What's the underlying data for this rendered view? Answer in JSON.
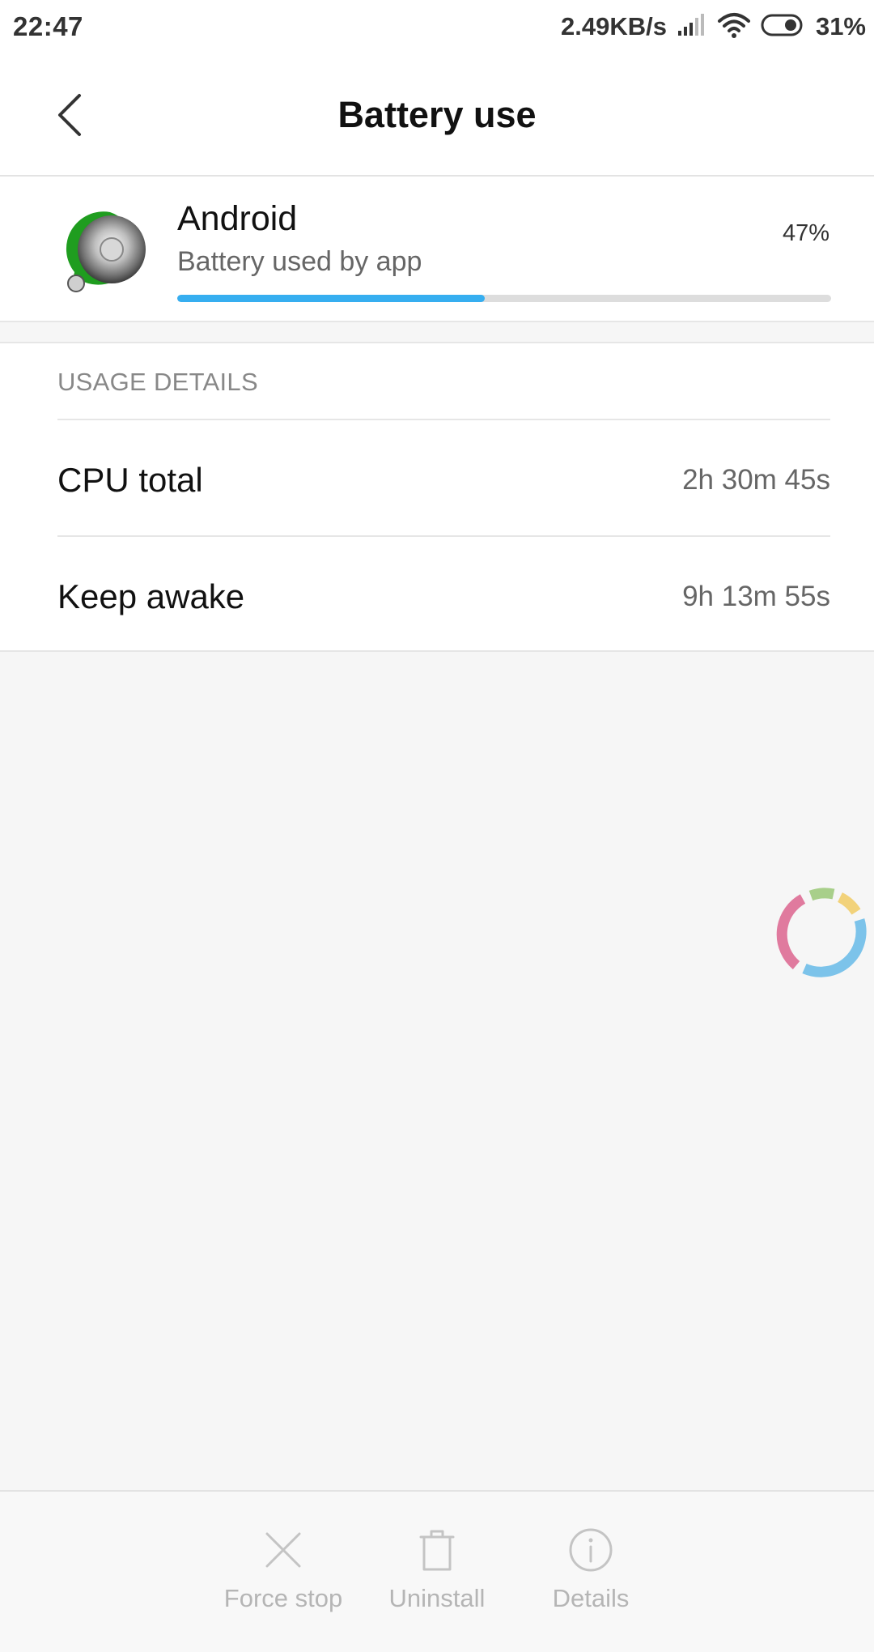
{
  "status_bar": {
    "time": "22:47",
    "network_speed": "2.49KB/s",
    "battery_percent": "31%",
    "icons": [
      "signal-icon",
      "wifi-icon",
      "battery-icon"
    ]
  },
  "header": {
    "title": "Battery use",
    "back_icon": "chevron-left-icon"
  },
  "app": {
    "name": "Android",
    "subtitle": "Battery used by app",
    "usage_percent_label": "47%",
    "usage_fraction": 0.47,
    "progress_color": "#36aef0"
  },
  "usage_details": {
    "section_title": "USAGE DETAILS",
    "rows": [
      {
        "label": "CPU total",
        "value": "2h 30m 45s"
      },
      {
        "label": "Keep awake",
        "value": "9h 13m 55s"
      }
    ]
  },
  "actions": [
    {
      "label": "Force stop",
      "icon": "close-icon"
    },
    {
      "label": "Uninstall",
      "icon": "trash-icon"
    },
    {
      "label": "Details",
      "icon": "info-icon"
    }
  ],
  "colors": {
    "accent": "#36aef0",
    "spinner": [
      "#e07a9e",
      "#a8cf8a",
      "#f2d27a",
      "#7cc3ea"
    ]
  }
}
